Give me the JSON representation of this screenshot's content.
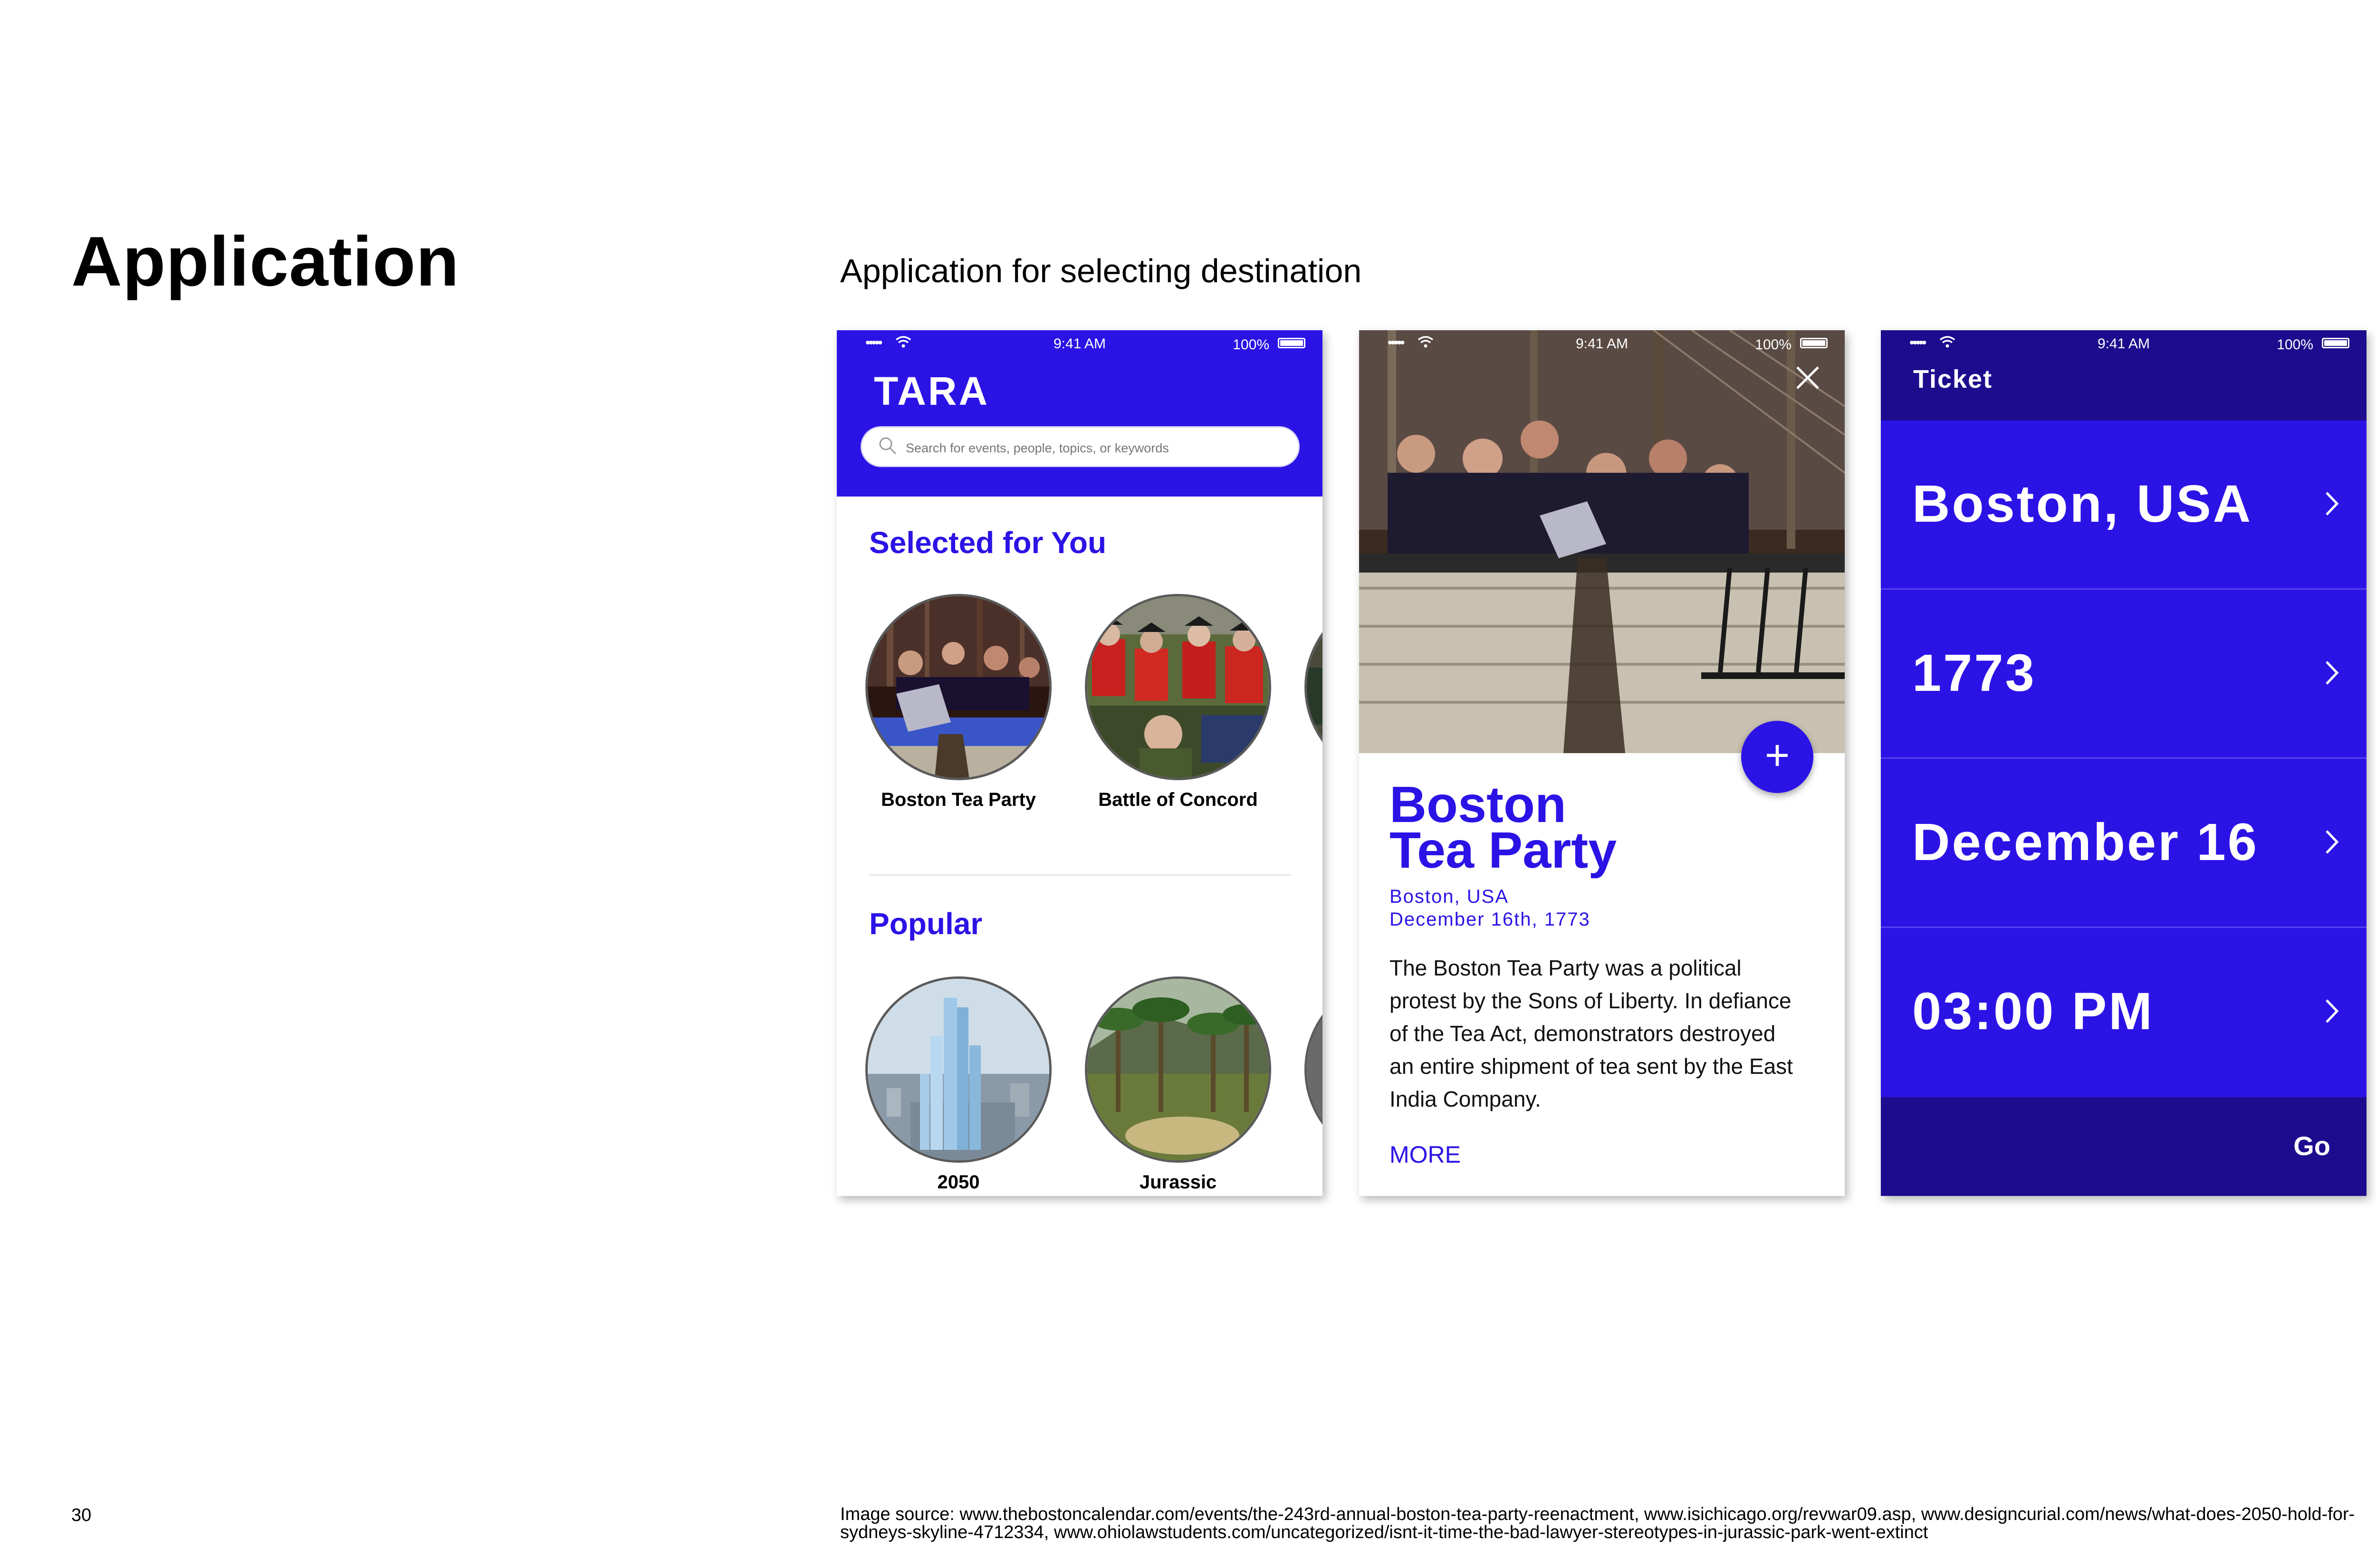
{
  "slide": {
    "title": "Application",
    "subtitle": "Application for selecting destination",
    "page_number": "30",
    "image_source": "Image source: www.thebostoncalendar.com/events/the-243rd-annual-boston-tea-party-reenactment, www.isichicago.org/revwar09.asp, www.designcurial.com/news/what-does-2050-hold-for-sydneys-skyline-4712334, www.ohiolawstudents.com/uncategorized/isnt-it-time-the-bad-lawyer-stereotypes-in-jurassic-park-went-extinct"
  },
  "status_bar": {
    "signal": "•••••",
    "time": "9:41 AM",
    "battery": "100%"
  },
  "phone1": {
    "logo": "TARA",
    "search": {
      "placeholder": "Search for events, people, topics, or keywords",
      "value": ""
    },
    "sections": [
      {
        "title": "Selected for You",
        "items": [
          {
            "label": "Boston Tea Party"
          },
          {
            "label": "Battle of Concord"
          }
        ]
      },
      {
        "title": "Popular",
        "items": [
          {
            "label": "2050"
          },
          {
            "label": "Jurassic"
          }
        ]
      }
    ]
  },
  "phone2": {
    "title_line1": "Boston",
    "title_line2": "Tea Party",
    "location": "Boston, USA",
    "date": "December 16th, 1773",
    "description": "The Boston Tea Party was a political protest by the Sons of Liberty. In defiance of the Tea Act, demonstrators destroyed an entire shipment of tea sent by the East India Company.",
    "more_label": "MORE",
    "fab_label": "+"
  },
  "phone3": {
    "header": "Ticket",
    "rows": [
      {
        "value": "Boston, USA"
      },
      {
        "value": "1773"
      },
      {
        "value": "December 16"
      },
      {
        "value": "03:00 PM"
      }
    ],
    "go_label": "Go"
  },
  "colors": {
    "accent": "#2b13e6",
    "accent_dark": "#1e0c8e"
  },
  "icons": [
    "wifi-icon",
    "battery-icon",
    "search-icon",
    "close-icon",
    "plus-icon",
    "chevron-right-icon"
  ]
}
